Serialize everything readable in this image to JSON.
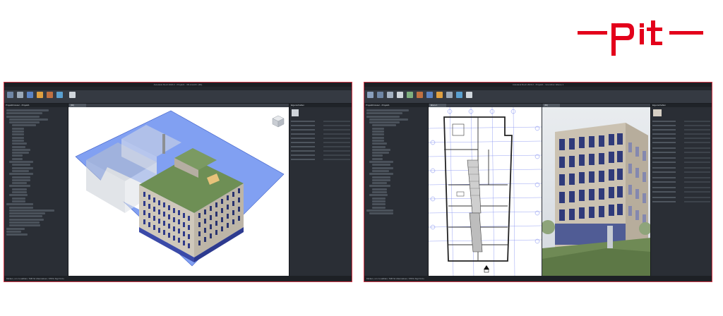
{
  "brand": {
    "logo_text": "pit",
    "color": "#e3001b"
  },
  "windows": [
    {
      "id": "left",
      "title": "Autodesk Revit 2020.2 - Projekt1 - 3D-Ansicht: {3D}",
      "menu": [
        "Datei",
        "Architektur",
        "Ingenieurbau",
        "Gebäudetechnik",
        "Einfügen",
        "Beschriften",
        "Analysieren",
        "Körpermodell & Grundstück",
        "Zusammenarbeit",
        "Ansicht",
        "Verwalten",
        "Zusatzmodule",
        "pitCAD",
        "Ändern | Ansichten"
      ],
      "active_menu_index": 13,
      "browser_title": "Projektbrowser - Projekt1",
      "properties_title": "Eigenschaften",
      "view_tab": "{3D}",
      "status_text": "Klicken, um zu wählen; TAB für Alternativen; STRG fügt hinzu"
    },
    {
      "id": "right",
      "title": "Autodesk Revit 2020.2 - Projekt1 - Grundriss: Ebene 1",
      "menu": [
        "Datei",
        "Architektur",
        "Ingenieurbau",
        "Gebäudetechnik",
        "Einfügen",
        "Beschriften",
        "Analysieren",
        "Körpermodell & Grundstück",
        "Zusammenarbeit",
        "Ansicht",
        "Verwalten",
        "Zusatzmodule",
        "pitCAD",
        "Ändern | Wände"
      ],
      "active_menu_index": 13,
      "browser_title": "Projektbrowser - Projekt1",
      "properties_title": "Eigenschaften",
      "view_tabs": [
        "Ebene 1",
        "{3D}"
      ],
      "status_text": "Klicken, um zu wählen; TAB für Alternativen; STRG fügt hinzu"
    }
  ],
  "colors": {
    "ui_dark": "#2b2f36",
    "site_blue": "#6b8ff0",
    "roof_green": "#6e8f55",
    "facade": "#cfc8bb",
    "window_blue": "#2f3a8a"
  }
}
